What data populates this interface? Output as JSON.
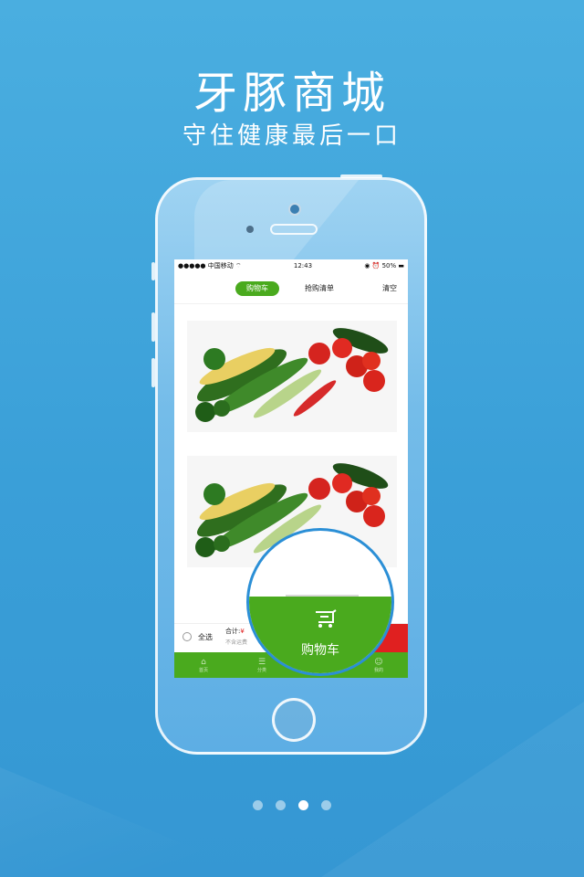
{
  "hero": {
    "title": "牙豚商城",
    "subtitle": "守住健康最后一口"
  },
  "status_bar": {
    "carrier": "●●●●● 中国移动 ⌔",
    "time": "12:43",
    "battery": "◉ ⏰ 50% ▬"
  },
  "top_nav": {
    "cart_tab": "购物车",
    "flash_tab": "抢购清单",
    "clear_label": "清空"
  },
  "cart_footer": {
    "select_all": "全选",
    "total_label": "合计:",
    "total_currency": "¥",
    "freight_note": "不含运费"
  },
  "tab_bar": {
    "items": [
      {
        "label": "首页",
        "icon": "home-icon"
      },
      {
        "label": "分类",
        "icon": "list-icon"
      },
      {
        "label": "",
        "icon": "cart-icon"
      },
      {
        "label": "我的",
        "icon": "smile-icon"
      }
    ]
  },
  "magnifier": {
    "label": "购物车",
    "icon": "cart-icon"
  },
  "pager": {
    "total": 4,
    "active_index": 2
  },
  "colors": {
    "accent_green": "#4aaa1e",
    "checkout_red": "#e02020",
    "background_blue": "#3a9fd8"
  }
}
